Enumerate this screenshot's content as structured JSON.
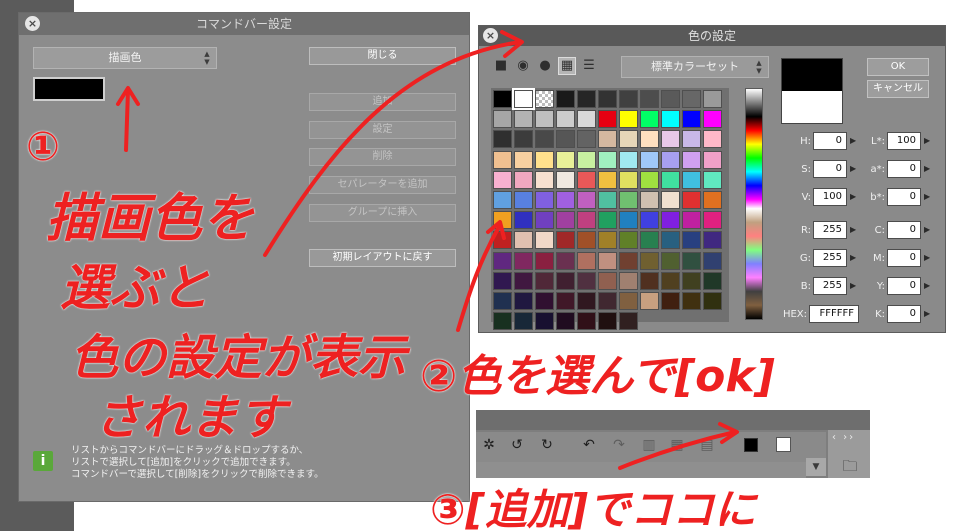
{
  "command_dialog": {
    "title": "コマンドバー設定",
    "selected_item": "描画色",
    "swatch_color": "#000000",
    "buttons": [
      {
        "label": "閉じる",
        "enabled": true
      },
      {
        "label": "追加",
        "enabled": false
      },
      {
        "label": "設定",
        "enabled": false
      },
      {
        "label": "削除",
        "enabled": false
      },
      {
        "label": "セパレーターを追加",
        "enabled": false
      },
      {
        "label": "グループに挿入",
        "enabled": false
      },
      {
        "label": "初期レイアウトに戻す",
        "enabled": true
      }
    ],
    "info_lines": [
      "リストからコマンドバーにドラッグ＆ドロップするか、",
      "リストで選択して[追加]をクリックで追加できます。",
      "コマンドバーで選択して[削除]をクリックで削除できます。"
    ]
  },
  "color_dialog": {
    "title": "色の設定",
    "palette_set": "標準カラーセット",
    "ok_label": "OK",
    "cancel_label": "キャンセル",
    "preview_colors": [
      "#000000",
      "#ffffff"
    ],
    "left_fields": [
      {
        "label": "H:",
        "value": "0"
      },
      {
        "label": "S:",
        "value": "0"
      },
      {
        "label": "V:",
        "value": "100"
      },
      {
        "label": "R:",
        "value": "255"
      },
      {
        "label": "G:",
        "value": "255"
      },
      {
        "label": "B:",
        "value": "255"
      }
    ],
    "right_fields": [
      {
        "label": "L*:",
        "value": "100"
      },
      {
        "label": "a*:",
        "value": "0"
      },
      {
        "label": "b*:",
        "value": "0"
      },
      {
        "label": "C:",
        "value": "0"
      },
      {
        "label": "M:",
        "value": "0"
      },
      {
        "label": "Y:",
        "value": "0"
      },
      {
        "label": "K:",
        "value": "0"
      }
    ],
    "hex_label": "HEX:",
    "hex_value": "FFFFFF",
    "swatches": [
      "#000000",
      "#ffffff",
      "checker",
      "#1a1a1a",
      "#262626",
      "#333333",
      "#404040",
      "#4d4d4d",
      "#5a5a5a",
      "#676767",
      "#9a9a9a",
      "#a6a6a6",
      "#b3b3b3",
      "#bfbfbf",
      "#cccccc",
      "#d9d9d9",
      "#e60012",
      "#ffff00",
      "#00ff66",
      "#00ffff",
      "#0000ff",
      "#ff00ff",
      "#2f2f2f",
      "#3c3c3c",
      "#494949",
      "#565656",
      "#636363",
      "#d4b8a0",
      "#e6d6b8",
      "#ffe0c0",
      "#e8c8e8",
      "#c8b8e8",
      "#ffb8c8",
      "#f0c090",
      "#f8d0a0",
      "#ffe08c",
      "#e8f098",
      "#c8f0a0",
      "#a0f0c0",
      "#a0e8f0",
      "#a0c8f8",
      "#a8a0f0",
      "#d0a0f0",
      "#f0a0c8",
      "#f8b0d0",
      "#f0a8c0",
      "#f8e0d0",
      "#f0e8e0",
      "#e85858",
      "#f0c040",
      "#e0e060",
      "#a0e040",
      "#40e0a0",
      "#40c0e0",
      "#60e8c0",
      "#60a0e0",
      "#5880e0",
      "#8060e0",
      "#a060e0",
      "#c060c0",
      "#50c0a0",
      "#70c070",
      "#d0c0b0",
      "#f0e0d0",
      "#e03030",
      "#e07020",
      "#f0a020",
      "#3030c0",
      "#7040c0",
      "#a040a0",
      "#c04080",
      "#20a060",
      "#2080c0",
      "#4040e0",
      "#8020e0",
      "#c020a0",
      "#e02080",
      "#c02020",
      "#e0c0b0",
      "#f0d8c8",
      "#a02828",
      "#a05028",
      "#a08028",
      "#608028",
      "#288050",
      "#286080",
      "#284080",
      "#402880",
      "#602880",
      "#802860",
      "#8a2040",
      "#6a3050",
      "#b07060",
      "#c09080",
      "#704030",
      "#706030",
      "#506030",
      "#305040",
      "#304070",
      "#301850",
      "#401840",
      "#502838",
      "#402030",
      "#503040",
      "#906050",
      "#a08070",
      "#503020",
      "#504020",
      "#404020",
      "#203828",
      "#203050",
      "#201840",
      "#301030",
      "#401828",
      "#301820",
      "#402830",
      "#806040",
      "#c8a080",
      "#402010",
      "#403010",
      "#303010",
      "#183020",
      "#182838",
      "#181030",
      "#200c20",
      "#301018",
      "#201010",
      "#302020"
    ]
  },
  "toolbar": {
    "icons": [
      "navigator-icon",
      "rotate-left-icon",
      "rotate-right-icon",
      "flip-icon",
      "undo-icon",
      "redo-icon",
      "grid-icon",
      "ruler-icon",
      "layer-icon"
    ],
    "colors": [
      "#000000",
      "#ffffff"
    ],
    "nav_label": "‹ ››"
  },
  "annotations": {
    "num1": "①",
    "line1a": "描画色を",
    "line1b": "選ぶと",
    "line1c": "色の設定が表示",
    "line1d": "されます",
    "step2": "②色を選んで[ok]",
    "step3": "③[追加]でココに",
    "ink_color": "#ee2121"
  }
}
